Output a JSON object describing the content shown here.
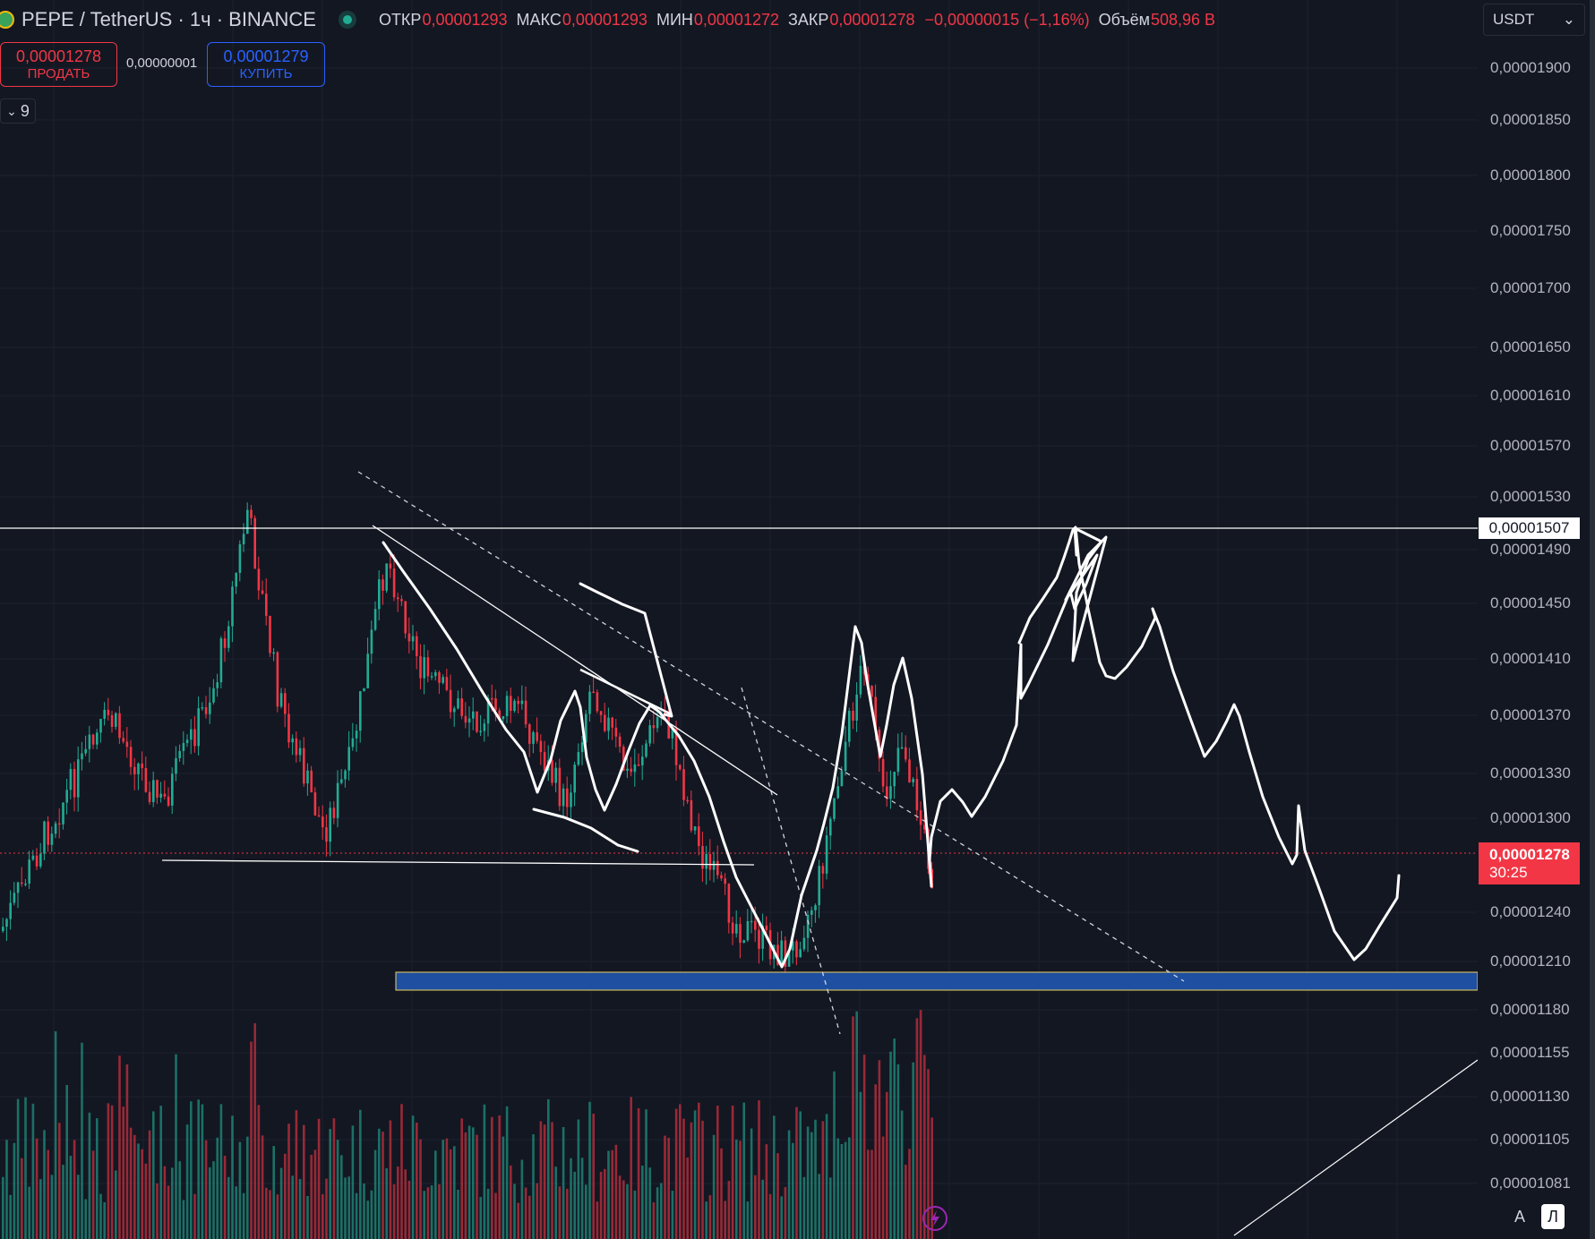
{
  "header": {
    "symbol_title": "PEPE / TetherUS · 1ч · BINANCE",
    "ohlc": {
      "open_label": "ОТКР",
      "open_value": "0,00001293",
      "high_label": "МАКС",
      "high_value": "0,00001293",
      "low_label": "МИН",
      "low_value": "0,00001272",
      "close_label": "ЗАКР",
      "close_value": "0,00001278",
      "change_value": "−0,00000015 (−1,16%)",
      "volume_label": "Объём",
      "volume_value": "508,96 B"
    },
    "currency": "USDT"
  },
  "trade": {
    "sell_price": "0,00001278",
    "sell_label": "ПРОДАТЬ",
    "spread": "0,00000001",
    "buy_price": "0,00001279",
    "buy_label": "КУПИТЬ"
  },
  "indicators": {
    "count": "9"
  },
  "price_axis": {
    "ticks": [
      "0,00001900",
      "0,00001850",
      "0,00001800",
      "0,00001750",
      "0,00001700",
      "0,00001650",
      "0,00001610",
      "0,00001570",
      "0,00001530",
      "0,00001490",
      "0,00001450",
      "0,00001410",
      "0,00001370",
      "0,00001330",
      "0,00001300",
      "0,00001240",
      "0,00001210",
      "0,00001180",
      "0,00001155",
      "0,00001130",
      "0,00001105",
      "0,00001081"
    ],
    "marker_level": "0,00001507",
    "current_price": "0,00001278",
    "countdown": "30:25"
  },
  "scale_buttons": {
    "auto": "A",
    "log": "Л"
  },
  "colors": {
    "background": "#131722",
    "up": "#22ab94",
    "down": "#f23645",
    "accent": "#2962ff",
    "zone": "#1e4fa0",
    "drawing": "#ffffff"
  },
  "icons": {
    "live": "live-status-dot-icon",
    "flash": "lightning-icon",
    "chevron": "chevron-down-icon"
  }
}
